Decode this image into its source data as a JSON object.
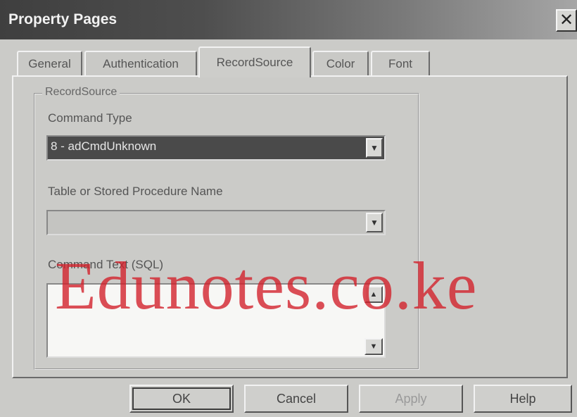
{
  "window": {
    "title": "Property Pages",
    "close_glyph": "✕"
  },
  "tabs": [
    {
      "label": "General"
    },
    {
      "label": "Authentication"
    },
    {
      "label": "RecordSource",
      "active": true
    },
    {
      "label": "Color"
    },
    {
      "label": "Font"
    }
  ],
  "recordsource": {
    "group_label": "RecordSource",
    "command_type_label": "Command Type",
    "command_type_value": "8 - adCmdUnknown",
    "table_label": "Table or Stored Procedure Name",
    "table_value": "",
    "command_text_label": "Command Text (SQL)",
    "command_text_value": ""
  },
  "buttons": {
    "ok": "OK",
    "cancel": "Cancel",
    "apply": "Apply",
    "help": "Help"
  },
  "watermark": "Edunotes.co.ke",
  "colors": {
    "title_bar": "#3f3f3f",
    "selected_combo": "#4a4a4a",
    "watermark": "#d21e28"
  }
}
